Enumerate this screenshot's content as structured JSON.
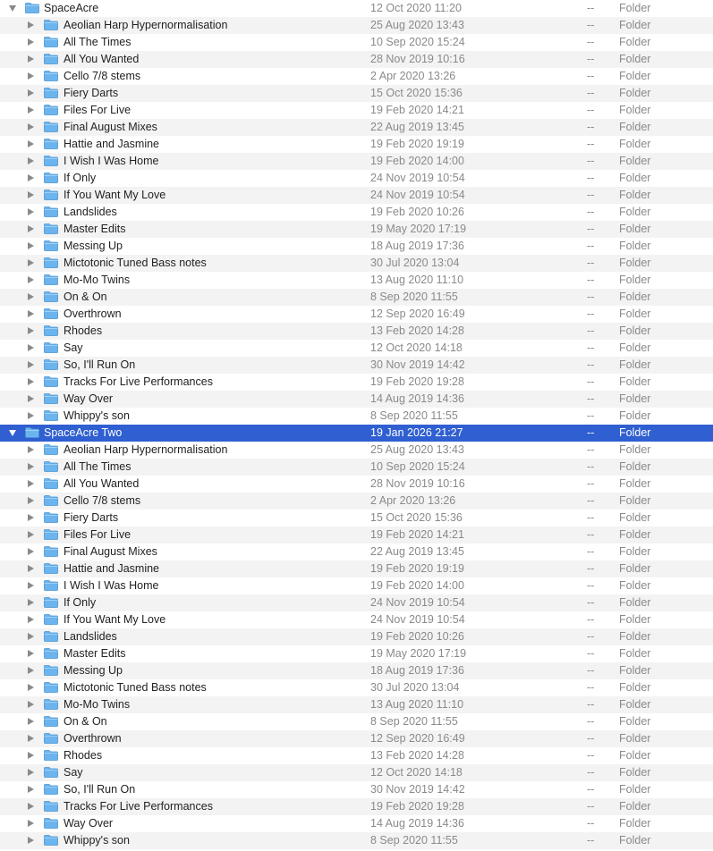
{
  "icons": {
    "disclosure": "disclosure-triangle-icon",
    "folder": "folder-icon",
    "folder_color": "#6cb4ee"
  },
  "colors": {
    "selection": "#2f5fd0",
    "alt_row": "#f3f3f3",
    "secondary_text": "#8a8a8a"
  },
  "groups": [
    {
      "name": "SpaceAcre",
      "date": "12 Oct 2020 11:20",
      "size": "--",
      "kind": "Folder",
      "expanded": true,
      "selected": false,
      "children": [
        {
          "name": "Aeolian Harp Hypernormalisation",
          "date": "25 Aug 2020 13:43",
          "size": "--",
          "kind": "Folder"
        },
        {
          "name": "All The Times",
          "date": "10 Sep 2020 15:24",
          "size": "--",
          "kind": "Folder"
        },
        {
          "name": "All You Wanted",
          "date": "28 Nov 2019 10:16",
          "size": "--",
          "kind": "Folder"
        },
        {
          "name": "Cello 7/8 stems",
          "date": "2 Apr 2020 13:26",
          "size": "--",
          "kind": "Folder"
        },
        {
          "name": "Fiery Darts",
          "date": "15 Oct 2020 15:36",
          "size": "--",
          "kind": "Folder"
        },
        {
          "name": "Files For Live",
          "date": "19 Feb 2020 14:21",
          "size": "--",
          "kind": "Folder"
        },
        {
          "name": "Final August Mixes",
          "date": "22 Aug 2019 13:45",
          "size": "--",
          "kind": "Folder"
        },
        {
          "name": "Hattie and Jasmine",
          "date": "19 Feb 2020 19:19",
          "size": "--",
          "kind": "Folder"
        },
        {
          "name": "I Wish I Was Home",
          "date": "19 Feb 2020 14:00",
          "size": "--",
          "kind": "Folder"
        },
        {
          "name": "If Only",
          "date": "24 Nov 2019 10:54",
          "size": "--",
          "kind": "Folder"
        },
        {
          "name": "If You Want My Love",
          "date": "24 Nov 2019 10:54",
          "size": "--",
          "kind": "Folder"
        },
        {
          "name": "Landslides",
          "date": "19 Feb 2020 10:26",
          "size": "--",
          "kind": "Folder"
        },
        {
          "name": "Master Edits",
          "date": "19 May 2020 17:19",
          "size": "--",
          "kind": "Folder"
        },
        {
          "name": "Messing Up",
          "date": "18 Aug 2019 17:36",
          "size": "--",
          "kind": "Folder"
        },
        {
          "name": "Mictotonic Tuned Bass notes",
          "date": "30 Jul 2020 13:04",
          "size": "--",
          "kind": "Folder"
        },
        {
          "name": "Mo-Mo Twins",
          "date": "13 Aug 2020 11:10",
          "size": "--",
          "kind": "Folder"
        },
        {
          "name": "On & On",
          "date": "8 Sep 2020 11:55",
          "size": "--",
          "kind": "Folder"
        },
        {
          "name": "Overthrown",
          "date": "12 Sep 2020 16:49",
          "size": "--",
          "kind": "Folder"
        },
        {
          "name": "Rhodes",
          "date": "13 Feb 2020 14:28",
          "size": "--",
          "kind": "Folder"
        },
        {
          "name": "Say",
          "date": "12 Oct 2020 14:18",
          "size": "--",
          "kind": "Folder"
        },
        {
          "name": "So, I'll Run On",
          "date": "30 Nov 2019 14:42",
          "size": "--",
          "kind": "Folder"
        },
        {
          "name": "Tracks For Live Performances",
          "date": "19 Feb 2020 19:28",
          "size": "--",
          "kind": "Folder"
        },
        {
          "name": "Way Over",
          "date": "14 Aug 2019 14:36",
          "size": "--",
          "kind": "Folder"
        },
        {
          "name": "Whippy's son",
          "date": "8 Sep 2020 11:55",
          "size": "--",
          "kind": "Folder"
        }
      ]
    },
    {
      "name": "SpaceAcre Two",
      "date": "19 Jan 2026 21:27",
      "size": "--",
      "kind": "Folder",
      "expanded": true,
      "selected": true,
      "children": [
        {
          "name": "Aeolian Harp Hypernormalisation",
          "date": "25 Aug 2020 13:43",
          "size": "--",
          "kind": "Folder"
        },
        {
          "name": "All The Times",
          "date": "10 Sep 2020 15:24",
          "size": "--",
          "kind": "Folder"
        },
        {
          "name": "All You Wanted",
          "date": "28 Nov 2019 10:16",
          "size": "--",
          "kind": "Folder"
        },
        {
          "name": "Cello 7/8 stems",
          "date": "2 Apr 2020 13:26",
          "size": "--",
          "kind": "Folder"
        },
        {
          "name": "Fiery Darts",
          "date": "15 Oct 2020 15:36",
          "size": "--",
          "kind": "Folder"
        },
        {
          "name": "Files For Live",
          "date": "19 Feb 2020 14:21",
          "size": "--",
          "kind": "Folder"
        },
        {
          "name": "Final August Mixes",
          "date": "22 Aug 2019 13:45",
          "size": "--",
          "kind": "Folder"
        },
        {
          "name": "Hattie and Jasmine",
          "date": "19 Feb 2020 19:19",
          "size": "--",
          "kind": "Folder"
        },
        {
          "name": "I Wish I Was Home",
          "date": "19 Feb 2020 14:00",
          "size": "--",
          "kind": "Folder"
        },
        {
          "name": "If Only",
          "date": "24 Nov 2019 10:54",
          "size": "--",
          "kind": "Folder"
        },
        {
          "name": "If You Want My Love",
          "date": "24 Nov 2019 10:54",
          "size": "--",
          "kind": "Folder"
        },
        {
          "name": "Landslides",
          "date": "19 Feb 2020 10:26",
          "size": "--",
          "kind": "Folder"
        },
        {
          "name": "Master Edits",
          "date": "19 May 2020 17:19",
          "size": "--",
          "kind": "Folder"
        },
        {
          "name": "Messing Up",
          "date": "18 Aug 2019 17:36",
          "size": "--",
          "kind": "Folder"
        },
        {
          "name": "Mictotonic Tuned Bass notes",
          "date": "30 Jul 2020 13:04",
          "size": "--",
          "kind": "Folder"
        },
        {
          "name": "Mo-Mo Twins",
          "date": "13 Aug 2020 11:10",
          "size": "--",
          "kind": "Folder"
        },
        {
          "name": "On & On",
          "date": "8 Sep 2020 11:55",
          "size": "--",
          "kind": "Folder"
        },
        {
          "name": "Overthrown",
          "date": "12 Sep 2020 16:49",
          "size": "--",
          "kind": "Folder"
        },
        {
          "name": "Rhodes",
          "date": "13 Feb 2020 14:28",
          "size": "--",
          "kind": "Folder"
        },
        {
          "name": "Say",
          "date": "12 Oct 2020 14:18",
          "size": "--",
          "kind": "Folder"
        },
        {
          "name": "So, I'll Run On",
          "date": "30 Nov 2019 14:42",
          "size": "--",
          "kind": "Folder"
        },
        {
          "name": "Tracks For Live Performances",
          "date": "19 Feb 2020 19:28",
          "size": "--",
          "kind": "Folder"
        },
        {
          "name": "Way Over",
          "date": "14 Aug 2019 14:36",
          "size": "--",
          "kind": "Folder"
        },
        {
          "name": "Whippy's son",
          "date": "8 Sep 2020 11:55",
          "size": "--",
          "kind": "Folder"
        }
      ]
    }
  ]
}
